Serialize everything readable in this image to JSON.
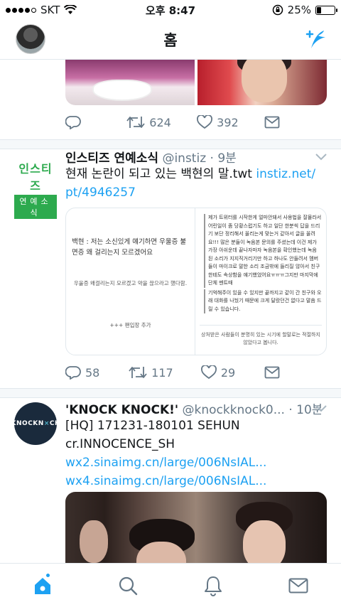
{
  "status_bar": {
    "carrier": "SKT",
    "time": "오후 8:47",
    "battery": "25%",
    "battery_level": 0.25
  },
  "header": {
    "title": "홈"
  },
  "tweet1": {
    "retweets": "624",
    "likes": "392"
  },
  "tweet2": {
    "logo_top": "인스티즈",
    "logo_bottom": "연예소식",
    "name": "인스티즈 연예소식",
    "handle": "@instiz · 9분",
    "text": "현재 논란이 되고 있는 백현의 말.twt",
    "link1": "instiz.net/",
    "link2": "pt/4946257",
    "card": {
      "quote": "백현 : 저는 소신있게 얘기하면 우울증 불면증 왜 걸리는지 모르겠어요",
      "sub": "우울증 왜걸리는지 모르겠고 약을 끊으라고 했다함.",
      "more": "+++ 팬입장 추가",
      "para1": "제가 트위터를 시작한게 얼마안돼서 사용법을 잘몰라서 어린일이 좀 당황스럽기도 하고 일단 한분씩 답을 드리기 보단 정리해서 올리는게 맞는거 같아서 글을 올려요!!! 많은 분들이 녹음본 문의를 주셨는데 이건 제가 가장 아쉬운데 끝나자마자 녹음본을 확인했는데 녹음 된 소리가 지지직거리기만 하고 하나도 안들려서 멤버들이 마이크로 말한 소리 조금밖에 들리질 않아서 친구한테도 속상함을 얘기했었어요ㅠㅠㅠ그지만 마지막에 단체 멘트때",
      "para2": "기억해주이 있을 수 있지만 끝까지고 같이 간 친구와 오래 대화를 나눴기 때문에 크게 달랐던건 없다고 말씀 드릴 수 있습니다.",
      "foot": "상처받은 사람들이 분명히 있는 시기에 할말로는 적절하지 않았다고 봅니다."
    },
    "replies": "58",
    "retweets": "117",
    "likes": "29"
  },
  "tweet3": {
    "logo_text": "KNOCKN",
    "logo_x": "×",
    "logo_end": "CK",
    "name": "'KNOCK KNOCK!'",
    "handle": "@knockknock0... · 10분",
    "line1": "[HQ] 171231-180101 SEHUN",
    "line2": "cr.INNOCENCE_SH",
    "link1": "wx2.sinaimg.cn/large/006NsIAL...",
    "link2": "wx4.sinaimg.cn/large/006NsIAL..."
  },
  "colors": {
    "accent": "#1da1f2",
    "muted": "#657786",
    "instiz_green": "#2daa4e"
  },
  "icons": [
    "compose-tweet-icon",
    "reply-icon",
    "retweet-icon",
    "like-icon",
    "dm-icon",
    "home-icon",
    "search-icon",
    "notifications-icon",
    "messages-icon"
  ]
}
